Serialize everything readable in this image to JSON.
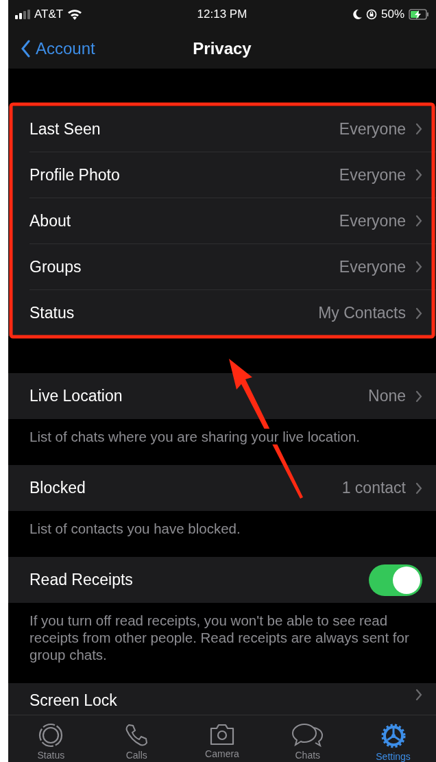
{
  "status_bar": {
    "carrier": "AT&T",
    "time": "12:13 PM",
    "battery": "50%"
  },
  "nav": {
    "back": "Account",
    "title": "Privacy"
  },
  "sections": [
    {
      "rows": [
        {
          "kind": "link",
          "label": "Last Seen",
          "value": "Everyone"
        },
        {
          "kind": "link",
          "label": "Profile Photo",
          "value": "Everyone"
        },
        {
          "kind": "link",
          "label": "About",
          "value": "Everyone"
        },
        {
          "kind": "link",
          "label": "Groups",
          "value": "Everyone"
        },
        {
          "kind": "link",
          "label": "Status",
          "value": "My Contacts"
        }
      ]
    },
    {
      "rows": [
        {
          "kind": "link",
          "label": "Live Location",
          "value": "None"
        }
      ],
      "footer": "List of chats where you are sharing your live location."
    },
    {
      "rows": [
        {
          "kind": "link",
          "label": "Blocked",
          "value": "1 contact"
        }
      ],
      "footer": "List of contacts you have blocked."
    },
    {
      "rows": [
        {
          "kind": "toggle",
          "label": "Read Receipts",
          "on": true
        }
      ],
      "footer": "If you turn off read receipts, you won't be able to see read receipts from other people. Read receipts are always sent for group chats."
    },
    {
      "rows": [
        {
          "kind": "link",
          "label": "Screen Lock"
        }
      ]
    }
  ],
  "annotations": {
    "highlight_box": true,
    "arrow": true
  },
  "tab_bar": [
    {
      "label": "Status",
      "selected": false
    },
    {
      "label": "Calls",
      "selected": false
    },
    {
      "label": "Camera",
      "selected": false
    },
    {
      "label": "Chats",
      "selected": false
    },
    {
      "label": "Settings",
      "selected": true
    }
  ]
}
